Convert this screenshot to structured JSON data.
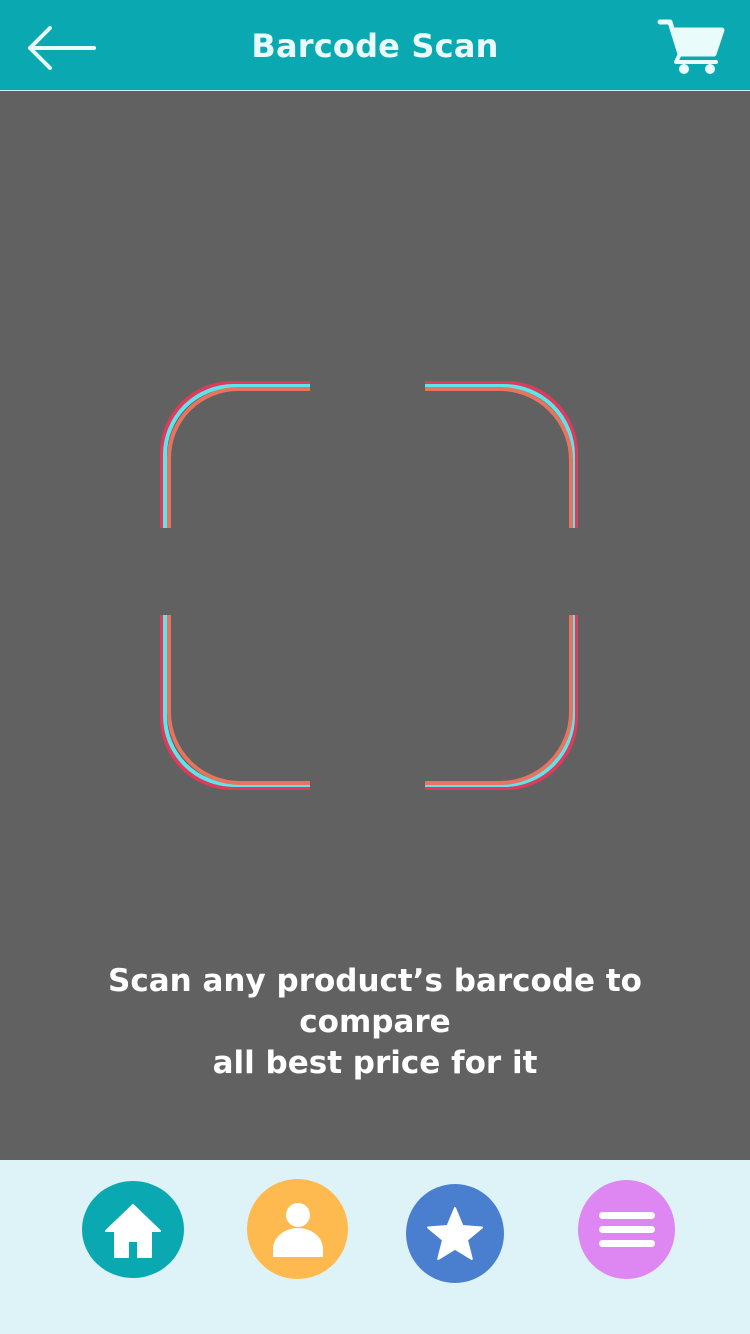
{
  "header": {
    "title": "Barcode Scan",
    "back_icon": "arrow-left-icon",
    "cart_icon": "shopping-cart-icon",
    "background_color": "#0aa9b2"
  },
  "scanner": {
    "instruction_line1": "Scan any product’s barcode to compare",
    "instruction_line2": "all best price for it",
    "frame_colors": [
      "#e03a5a",
      "#5ce6ec",
      "#e8735e"
    ]
  },
  "bottom_nav": {
    "background_color": "#ddf3f7",
    "items": [
      {
        "icon": "home-icon",
        "color": "#0aa9b2"
      },
      {
        "icon": "user-icon",
        "color": "#feba4e"
      },
      {
        "icon": "star-icon",
        "color": "#4a7fd0"
      },
      {
        "icon": "menu-icon",
        "color": "#de86f2"
      }
    ]
  }
}
